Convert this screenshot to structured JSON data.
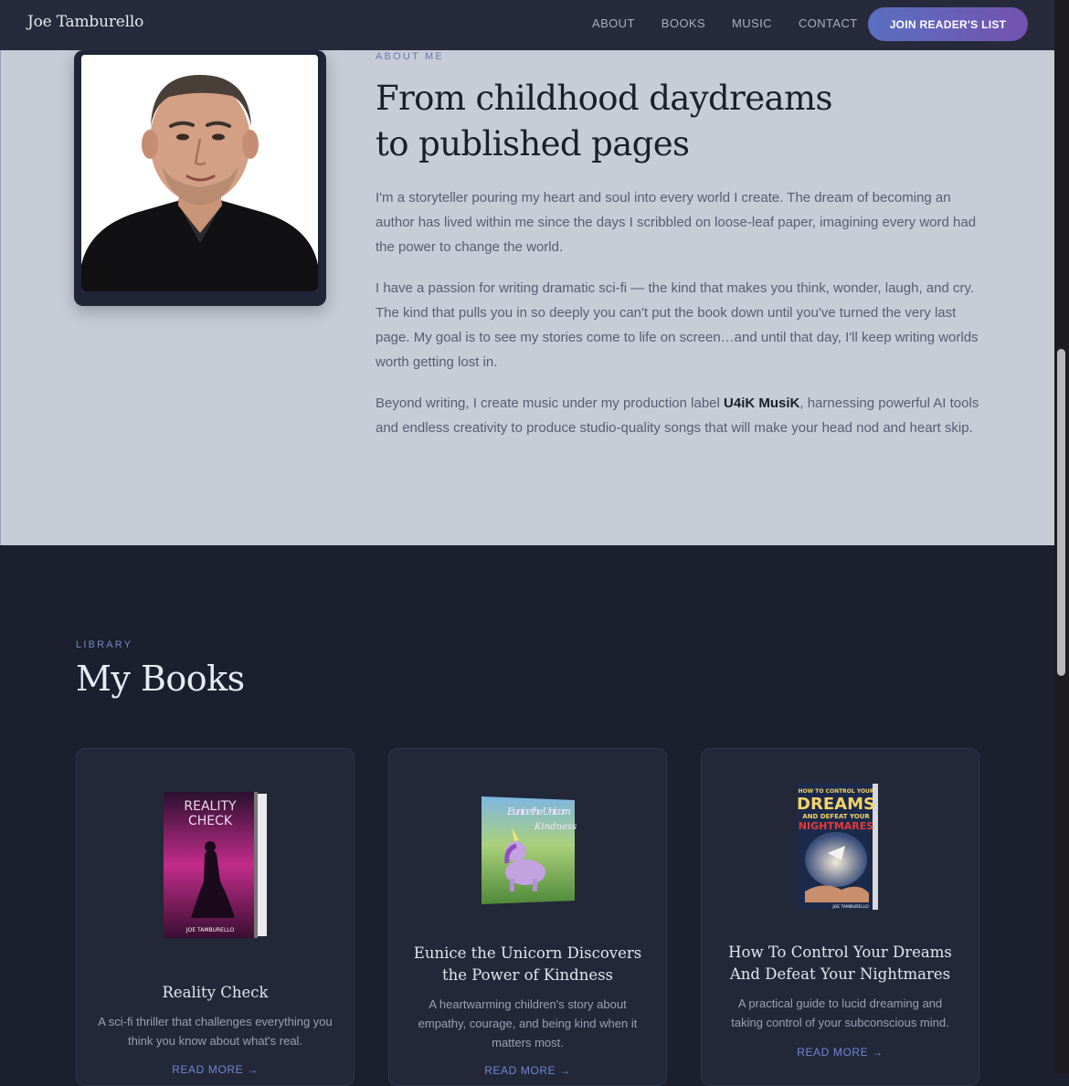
{
  "brand": "Joe Tamburello",
  "nav": {
    "links": [
      "ABOUT",
      "BOOKS",
      "MUSIC",
      "CONTACT"
    ],
    "cta": "JOIN READER'S LIST"
  },
  "about": {
    "eyebrow": "ABOUT ME",
    "title_line1": "From childhood daydreams",
    "title_line2": "to published pages",
    "p1": "I'm a storyteller pouring my heart and soul into every world I create. The dream of becoming an author has lived within me since the days I scribbled on loose-leaf paper, imagining every word had the power to change the world.",
    "p2": "I have a passion for writing dramatic sci-fi — the kind that makes you think, wonder, laugh, and cry. The kind that pulls you in so deeply you can't put the book down until you've turned the very last page. My goal is to see my stories come to life on screen…and until that day, I'll keep writing worlds worth getting lost in.",
    "p3_before": "Beyond writing, I create music under my production label ",
    "p3_label": "U4iK MusiK",
    "p3_after": ", harnessing powerful AI tools and endless creativity to produce studio-quality songs that will make your head nod and heart skip."
  },
  "library": {
    "eyebrow": "LIBRARY",
    "title": "My Books",
    "books": [
      {
        "title": "Reality Check",
        "desc": "A sci-fi thriller that challenges everything you think you know about what's real.",
        "cta": "READ MORE →",
        "cover_title_1": "REALITY",
        "cover_title_2": "CHECK",
        "cover_author": "JOE TAMBURELLO"
      },
      {
        "title": "Eunice the Unicorn Discovers the Power of Kindness",
        "desc": "A heartwarming children's story about empathy, courage, and being kind when it matters most.",
        "cta": "READ MORE →",
        "cover_title_1": "Eunice the Unicorn",
        "cover_title_2": "Kindness"
      },
      {
        "title": "How To Control Your Dreams And Defeat Your Nightmares",
        "desc": "A practical guide to lucid dreaming and taking control of your subconscious mind.",
        "cta": "READ MORE →",
        "cover_title_1": "HOW TO CONTROL YOUR",
        "cover_title_2": "DREAMS",
        "cover_title_3": "AND DEFEAT YOUR",
        "cover_title_4": "NIGHTMARES",
        "cover_author": "JOE TAMBURELLO"
      }
    ]
  },
  "colors": {
    "nav_bg": "#262a3a",
    "about_bg": "#c8ccd7",
    "library_bg": "#1b1f2e",
    "accent": "#6f86d4",
    "cta_gradient_start": "#5a6fc0",
    "cta_gradient_end": "#7452b0"
  }
}
